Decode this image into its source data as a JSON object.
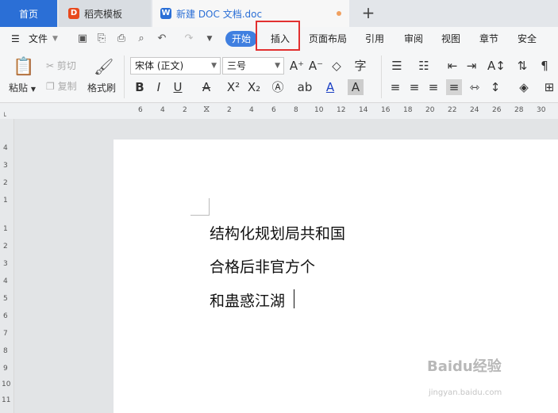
{
  "tabs": {
    "home": "首页",
    "templates": "稻壳模板",
    "doc": "新建 DOC 文档.doc",
    "new_tab": "+"
  },
  "menu": {
    "file": "文件",
    "start": "开始",
    "insert": "插入",
    "layout": "页面布局",
    "reference": "引用",
    "review": "审阅",
    "view": "视图",
    "section": "章节",
    "security": "安全"
  },
  "ribbon": {
    "paste": "粘贴",
    "cut": "剪切",
    "copy": "复制",
    "format_painter": "格式刷",
    "font_name": "宋体 (正文)",
    "font_size": "三号"
  },
  "ruler": {
    "h": [
      "6",
      "4",
      "2",
      "2",
      "4",
      "6",
      "8",
      "10",
      "12",
      "14",
      "16",
      "18",
      "20",
      "22",
      "24",
      "26",
      "28",
      "30"
    ],
    "v": [
      "4",
      "3",
      "2",
      "1",
      "1",
      "2",
      "3",
      "4",
      "5",
      "6",
      "7",
      "8",
      "9",
      "10",
      "11"
    ]
  },
  "document": {
    "lines": [
      "结构化规划局共和国",
      "合格后非官方个",
      "和蛊惑江湖"
    ]
  },
  "watermark": {
    "brand": "Baidu经验",
    "url": "jingyan.baidu.com"
  },
  "colors": {
    "accent": "#3f7fe0",
    "highlight": "#e23030"
  }
}
